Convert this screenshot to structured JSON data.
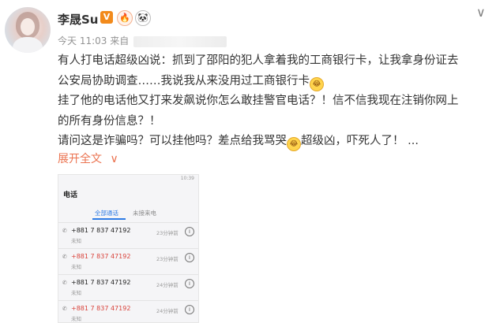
{
  "user": {
    "name": "李晟Su",
    "vip_mark": "V",
    "badge_fire": "🔥",
    "badge_panda": "🐼"
  },
  "meta": {
    "time": "今天 11:03 来自"
  },
  "header": {
    "more_icon": "chevron-down-icon"
  },
  "post": {
    "lines": [
      "有人打电话超级凶说：抓到了邵阳的犯人拿着我的工商银行卡，让我拿身份证去",
      "公安局协助调查……我说我从来没用过工商银行卡",
      "挂了他的电话他又打来发飙说你怎么敢挂警官电话？！信不信我现在注销你网上",
      "的所有身份信息？！",
      "请问这是诈骗吗？可以挂他吗？差点给我骂哭",
      "超级凶，吓死人了！ ..."
    ],
    "emoji_label": "😂",
    "expand_label": "展开全文",
    "expand_chevron": "∨"
  },
  "screenshot": {
    "status": "10:39",
    "title": "电话",
    "tab_all": "全部通话",
    "tab_missed": "未接来电",
    "calls": [
      {
        "number": "+881 7 837 47192",
        "label": "未知",
        "time": "23分钟前",
        "missed": false
      },
      {
        "number": "+881 7 837 47192",
        "label": "未知",
        "time": "23分钟前",
        "missed": true
      },
      {
        "number": "+881 7 837 47192",
        "label": "未知",
        "time": "24分钟前",
        "missed": false
      },
      {
        "number": "+881 7 837 47192",
        "label": "未知",
        "time": "24分钟前",
        "missed": true
      }
    ],
    "info_icon": "i"
  },
  "colors": {
    "accent": "#eb7350",
    "vip": "#f28a1b",
    "missed_red": "#d9433b",
    "tab_blue": "#2d7be5"
  }
}
